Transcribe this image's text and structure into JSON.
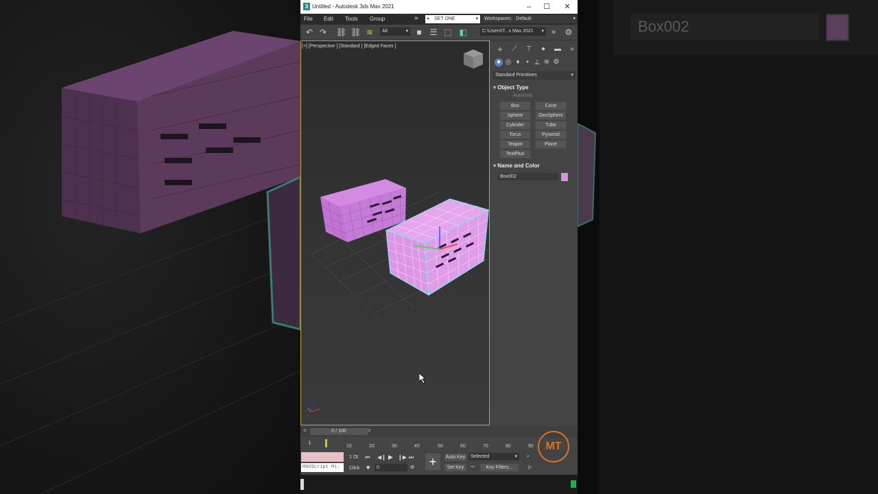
{
  "window": {
    "title": "Untitled - Autodesk 3ds Max 2021",
    "app_icon": "3"
  },
  "menu": {
    "items": [
      "File",
      "Edit",
      "Tools",
      "Group"
    ],
    "more": "»",
    "selection_set": "SET ONE",
    "workspaces_label": "Workspaces:",
    "workspaces_value": "Default"
  },
  "toolbar": {
    "filter": "All",
    "path": "C:\\Users\\T...s Max 2021",
    "more": "»"
  },
  "viewport": {
    "label": "[+] [Perspective ] [Standard ] [Edged Faces ]"
  },
  "command_panel": {
    "category": "Standard Primitives",
    "object_type_title": "Object Type",
    "autogrid": "AutoGrid",
    "buttons": [
      "Box",
      "Cone",
      "Sphere",
      "GeoSphere",
      "Cylinder",
      "Tube",
      "Torus",
      "Pyramid",
      "Teapot",
      "Plane",
      "TextPlus"
    ],
    "name_color_title": "Name and Color",
    "object_name": "Box002",
    "object_color": "#dd8ce8"
  },
  "timeline": {
    "frame": "0 / 100",
    "ticks": [
      "10",
      "20",
      "30",
      "40",
      "50",
      "60",
      "70",
      "80",
      "90"
    ]
  },
  "bottom": {
    "maxscript": "MAXScript Mi:",
    "obj_count": "1 Ot",
    "click": "Click",
    "frame_value": "0",
    "auto_key": "Auto Key",
    "set_key": "Set Key",
    "selected": "Selected",
    "key_filters": "Key Filters..."
  },
  "background": {
    "name": "Box002"
  },
  "logo": {
    "text": "MT"
  }
}
